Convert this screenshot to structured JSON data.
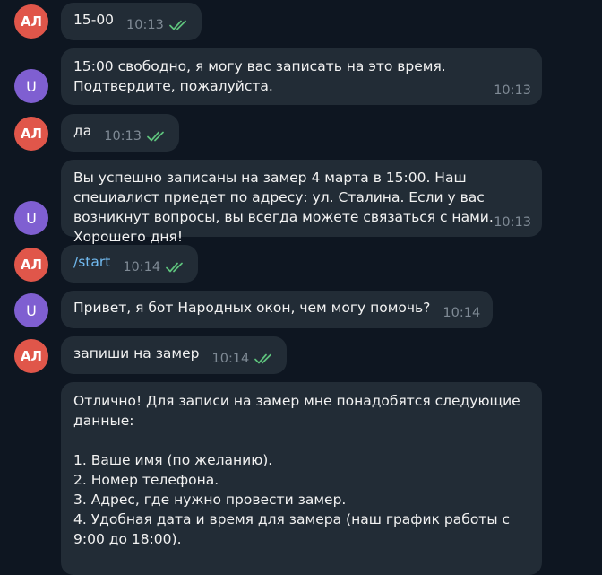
{
  "messages": [
    {
      "sender": "АЛ",
      "text": "15-00",
      "time": "10:13",
      "read": true
    },
    {
      "sender": "U",
      "text": "15:00 свободно, я могу вас записать на это время. Подтвердите, пожалуйста.",
      "time": "10:13"
    },
    {
      "sender": "АЛ",
      "text": "да",
      "time": "10:13",
      "read": true
    },
    {
      "sender": "U",
      "text": "Вы успешно записаны на замер 4 марта в 15:00. Наш специалист приедет по адресу: ул. Сталина. Если у вас возникнут вопросы, вы всегда можете связаться с нами. Хорошего дня!",
      "time": "10:13"
    },
    {
      "sender": "АЛ",
      "text": "/start",
      "time": "10:14",
      "read": true
    },
    {
      "sender": "U",
      "text": "Привет, я бот Народных окон, чем могу помочь?",
      "time": "10:14"
    },
    {
      "sender": "АЛ",
      "text": "запиши на замер",
      "time": "10:14",
      "read": true
    },
    {
      "sender": "U",
      "text": "Отлично! Для записи на замер мне понадобятся следующие данные:\n\n1. Ваше имя (по желанию).\n2. Номер телефона.\n3. Адрес, где нужно провести замер.\n4. Удобная дата и время для замера (наш график работы с 9:00 до 18:00)."
    }
  ],
  "colors": {
    "background": "#0e1621",
    "bubble": "#222c36",
    "avatar_user": "#e0564a",
    "avatar_bot": "#7f5fd1",
    "read_checks": "#5ec37d",
    "command_link": "#71baf0"
  },
  "icons": {
    "read_status": "double-check-icon"
  }
}
